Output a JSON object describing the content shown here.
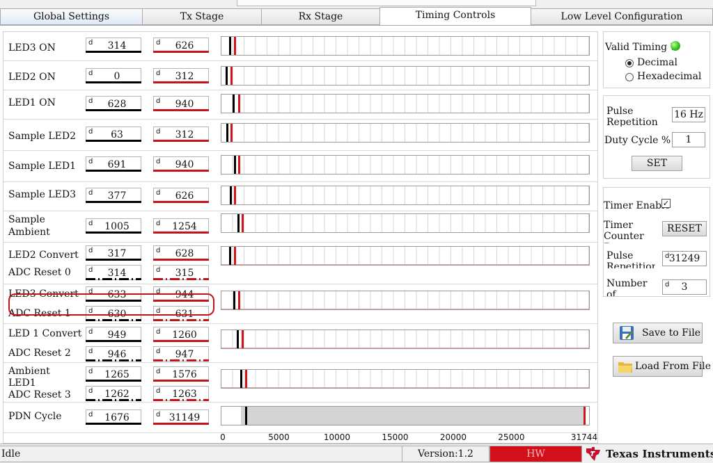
{
  "tabs": [
    {
      "label": "Global Settings"
    },
    {
      "label": "Tx Stage"
    },
    {
      "label": "Rx Stage"
    },
    {
      "label": "Timing Controls"
    },
    {
      "label": "Low Level Configuration"
    }
  ],
  "timing": {
    "rows": [
      {
        "labels": [
          "LED3 ON"
        ],
        "start": "314",
        "end": "626"
      },
      {
        "labels": [
          "LED2 ON"
        ],
        "start": "0",
        "end": "312"
      },
      {
        "labels": [
          "LED1 ON"
        ],
        "start": "628",
        "end": "940"
      },
      {
        "labels": [
          "Sample LED2"
        ],
        "start": "63",
        "end": "312"
      },
      {
        "labels": [
          "Sample LED1"
        ],
        "start": "691",
        "end": "940"
      },
      {
        "labels": [
          "Sample LED3"
        ],
        "start": "377",
        "end": "626"
      },
      {
        "labels": [
          "Sample",
          "Ambient"
        ],
        "start": "1005",
        "end": "1254"
      },
      {
        "labels": [
          "LED2 Convert",
          "ADC Reset 0"
        ],
        "start": "317",
        "end": "628",
        "reset_start": "314",
        "reset_end": "315"
      },
      {
        "labels": [
          "LED3 Convert",
          "ADC Reset 1"
        ],
        "start": "633",
        "end": "944",
        "reset_start": "630",
        "reset_end": "631"
      },
      {
        "labels": [
          "LED 1 Convert",
          "ADC Reset 2"
        ],
        "start": "949",
        "end": "1260",
        "reset_start": "946",
        "reset_end": "947"
      },
      {
        "labels": [
          "Ambient",
          "LED1",
          "ADC Reset 3"
        ],
        "start": "1265",
        "end": "1576",
        "reset_start": "1262",
        "reset_end": "1263"
      },
      {
        "labels": [
          "PDN Cycle"
        ],
        "start": "1676",
        "end": "31149"
      }
    ],
    "value_prefix": "d",
    "axis": {
      "min": 0,
      "max": 31744,
      "ticks": [
        "0",
        "5000",
        "10000",
        "15000",
        "20000",
        "25000",
        "31744"
      ],
      "tick_values": [
        0,
        5000,
        10000,
        15000,
        20000,
        25000,
        31744
      ]
    }
  },
  "right": {
    "valid_timing_label": "Valid Timing ?",
    "valid_timing_color": "#36c21f",
    "format_decimal": "Decimal",
    "format_hex": "Hexadecimal",
    "selected_format": "Decimal",
    "prf_label": "Pulse Repetition Frequency",
    "prf_value": "16 Hz",
    "duty_label": "Duty Cycle %",
    "duty_value": "1",
    "set_label": "SET",
    "timer_enable_label": "Timer Enable",
    "timer_enable_checked": true,
    "timer_counter_reset_label": "Timer Counter Reset",
    "reset_button": "RESET",
    "pulse_rep_label": "Pulse Repetition",
    "pulse_rep_value": "31249",
    "num_avg_label": "Number of Averages",
    "num_avg_value": "3",
    "save_label": "Save to File",
    "load_label": "Load From File"
  },
  "status": {
    "text": "Idle",
    "version": "Version:1.2",
    "hw": "HW",
    "hw_color": "#d1101a",
    "brand": "Texas Instruments"
  },
  "colors": {
    "start_marker": "#000000",
    "end_marker": "#d0141a",
    "highlight": "#c0141a"
  }
}
